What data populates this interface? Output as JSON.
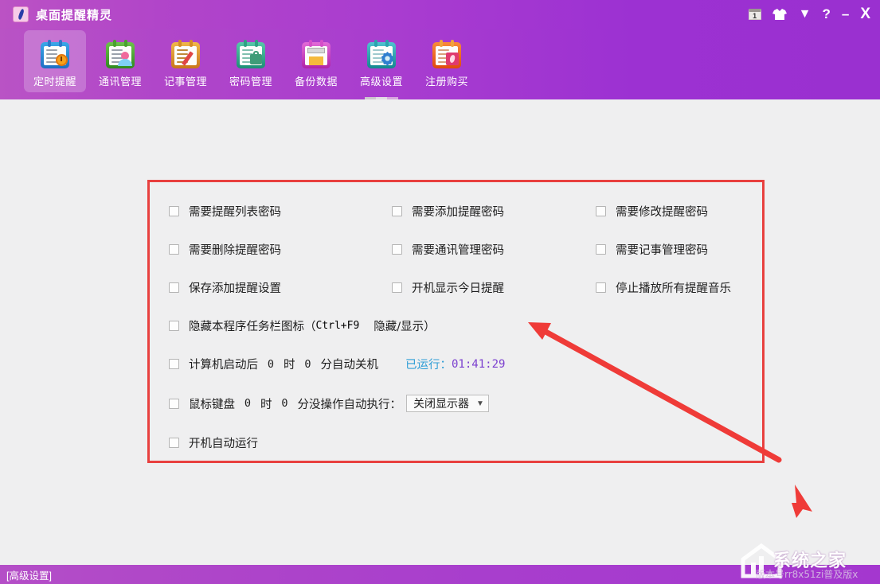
{
  "window": {
    "title": "桌面提醒精灵",
    "logo_icon": "app-logo-icon",
    "titlebar_buttons": [
      {
        "name": "calendar-icon",
        "label": "1"
      },
      {
        "name": "shirt-icon",
        "label": ""
      },
      {
        "name": "chevron-down-icon",
        "label": "▼"
      },
      {
        "name": "help-button",
        "label": "?"
      },
      {
        "name": "minimize-button",
        "label": "–"
      },
      {
        "name": "close-button",
        "label": "X"
      }
    ]
  },
  "toolbar": {
    "tabs": [
      {
        "label": "定时提醒",
        "icon": "calendar-clock-icon",
        "active": true,
        "selected": false
      },
      {
        "label": "通讯管理",
        "icon": "contacts-icon",
        "active": false,
        "selected": false
      },
      {
        "label": "记事管理",
        "icon": "notes-pencil-icon",
        "active": false,
        "selected": false
      },
      {
        "label": "密码管理",
        "icon": "password-bag-icon",
        "active": false,
        "selected": false
      },
      {
        "label": "备份数据",
        "icon": "backup-disk-icon",
        "active": false,
        "selected": false
      },
      {
        "label": "高级设置",
        "icon": "settings-gear-icon",
        "active": false,
        "selected": true
      },
      {
        "label": "注册购买",
        "icon": "register-buy-icon",
        "active": false,
        "selected": false
      }
    ]
  },
  "settings": {
    "checkboxes": [
      {
        "id": "need-reminder-list-password",
        "label": "需要提醒列表密码",
        "checked": false
      },
      {
        "id": "need-add-reminder-password",
        "label": "需要添加提醒密码",
        "checked": false
      },
      {
        "id": "need-modify-reminder-password",
        "label": "需要修改提醒密码",
        "checked": false
      },
      {
        "id": "need-delete-reminder-password",
        "label": "需要删除提醒密码",
        "checked": false
      },
      {
        "id": "need-contacts-manage-password",
        "label": "需要通讯管理密码",
        "checked": false
      },
      {
        "id": "need-notes-manage-password",
        "label": "需要记事管理密码",
        "checked": false
      },
      {
        "id": "save-add-reminder-settings",
        "label": "保存添加提醒设置",
        "checked": false
      },
      {
        "id": "show-today-reminder-on-boot",
        "label": "开机显示今日提醒",
        "checked": false
      },
      {
        "id": "stop-all-reminder-music",
        "label": "停止播放所有提醒音乐",
        "checked": false
      }
    ],
    "hide_taskbar_icon": {
      "label_prefix": "隐藏本程序任务栏图标（",
      "hotkey": "Ctrl+F9",
      "label_suffix": "隐藏/显示）",
      "checked": false
    },
    "auto_shutdown": {
      "label_prefix": "计算机启动后",
      "hours": "0",
      "hours_unit": "时",
      "minutes": "0",
      "minutes_unit": "分自动关机",
      "uptime_label": "已运行：",
      "uptime_value": "01:41:29",
      "checked": false
    },
    "idle_action": {
      "label_prefix": "鼠标键盘",
      "hours": "0",
      "hours_unit": "时",
      "minutes": "0",
      "minutes_unit": "分没操作自动执行：",
      "selected_option": "关闭显示器",
      "caret": "▼",
      "checked": false
    },
    "auto_run_on_boot": {
      "label": "开机自动运行",
      "checked": false
    }
  },
  "statusbar": {
    "text": "[高级设置]"
  },
  "watermark": {
    "brand": "系统之家",
    "version": "版本号rr8x51zi普及版x"
  },
  "annotations": {
    "box_color": "#e8403f",
    "arrow_color": "#ef3b38"
  }
}
